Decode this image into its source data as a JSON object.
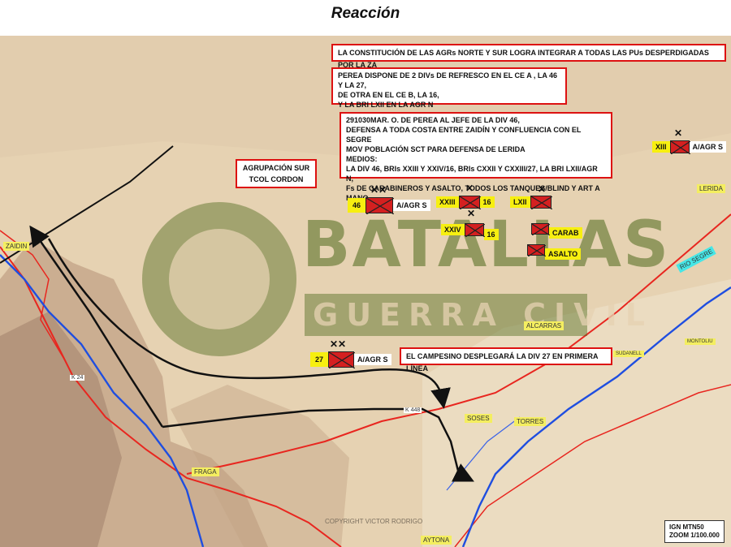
{
  "title": "Reacción",
  "watermark": {
    "line1": "BATALLAS",
    "line2": "GUERRA CIVIL"
  },
  "notes": {
    "n1": "LA CONSTITUCIÓN DE LAS AGRs NORTE  Y SUR  LOGRA  INTEGRAR A TODAS LAS PUs DESPERDIGADAS POR LA ZA",
    "n2": [
      "PEREA DISPONE DE 2 DIVs DE REFRESCO EN EL CE A , LA 46 Y LA 27,",
      "DE OTRA EN EL CE B, LA 16,",
      "Y LA BRI LXII EN LA AGR N"
    ],
    "n3": [
      "291030MAR. O. DE PEREA AL JEFE DE LA  DIV 46,",
      "DEFENSA A TODA COSTA ENTRE ZAIDÍN  Y CONFLUENCIA  CON EL SEGRE",
      "MOV POBLACIÓN SCT PARA DEFENSA DE LERIDA",
      "MEDIOS:",
      "LA DIV 46, BRIs  XXIII Y XXIV/16, BRIs CXXII Y CXXIII/27, LA BRI LXII/AGR N,",
      "Fs DE CARABINEROS Y ASALTO, TODOS LOS TANQUES/BLIND Y ART A MANO."
    ],
    "n4": [
      "AGRUPACIÓN SUR",
      "TCOL CORDON"
    ],
    "n5": "EL CAMPESINO DESPLEGARÁ LA DIV 27 EN PRIMERA LÍNEA"
  },
  "units": {
    "u46": {
      "left": "46",
      "right": "A/AGR S",
      "marks": "✕✕"
    },
    "uXXIII": {
      "left": "XXIII",
      "right": "16",
      "marks": "✕"
    },
    "uXXIV": {
      "left": "XXIV",
      "right": "16",
      "marks": "✕"
    },
    "uLXII": {
      "left": "LXII",
      "marks": "✕"
    },
    "uCARAB": {
      "right": "CARAB"
    },
    "uASALTO": {
      "right": "ASALTO"
    },
    "uXIII": {
      "left": "XIII",
      "right": "A/AGR S",
      "marks": "✕"
    },
    "u27": {
      "left": "27",
      "right": "A/AGR S",
      "marks": "✕✕"
    }
  },
  "places": {
    "zaidin": "ZAIDIN",
    "lerida": "LERIDA",
    "alcarras": "ALCARRAS",
    "soses": "SOSES",
    "torres": "TORRES",
    "fraga": "FRAGA",
    "aytona": "AYTONA",
    "sudanell": "SUDANELL",
    "montoliu": "MONTOLIU"
  },
  "roads": {
    "k24": "K 24",
    "k448": "K 448"
  },
  "river": "RIO SEGRE",
  "credit": "COPYRIGHT VICTOR RODRIGO",
  "map_info": [
    "IGN MTN50",
    "ZOOM 1/100.000"
  ],
  "colors": {
    "unit_red": "#d42020",
    "label_yellow": "#f7ef10",
    "note_border": "#dd1111",
    "road_red": "#e8261f",
    "river_blue": "#1f4ee0",
    "arrow_black": "#111111"
  }
}
